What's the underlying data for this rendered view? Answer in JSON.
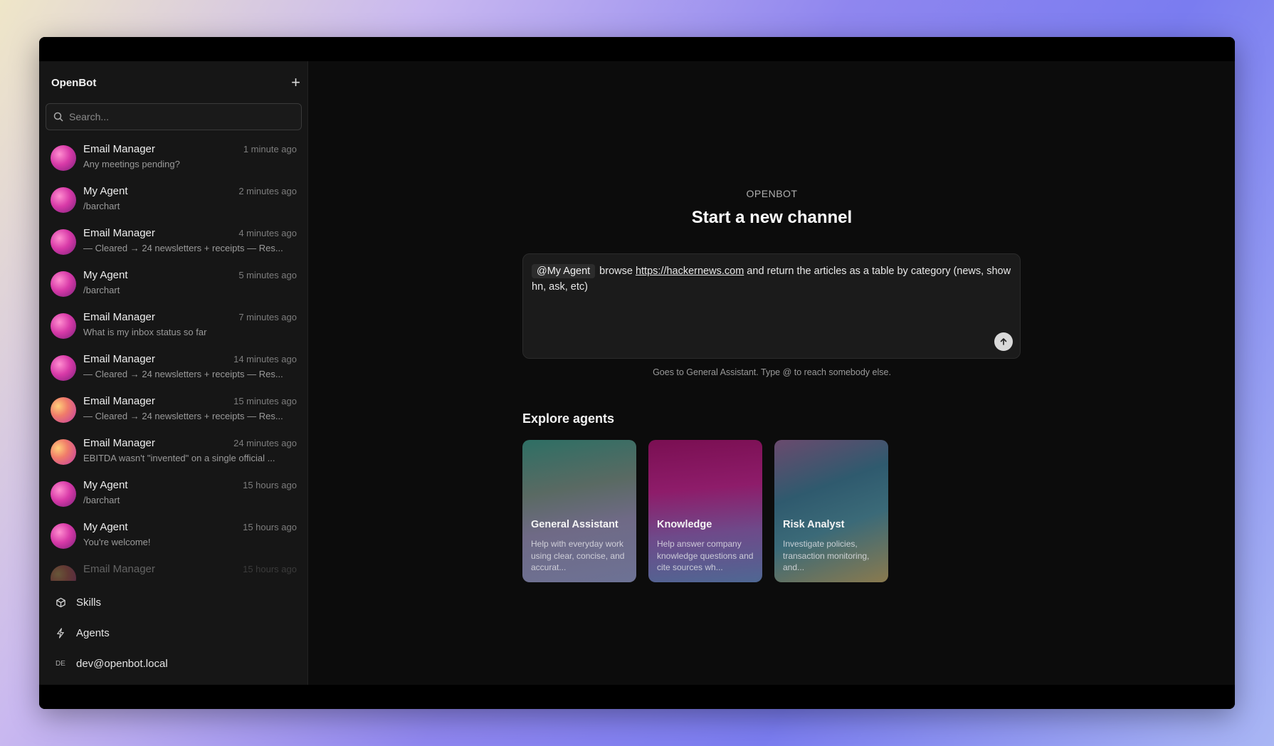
{
  "app": {
    "title": "OpenBot"
  },
  "search": {
    "placeholder": "Search..."
  },
  "conversations": [
    {
      "name": "Email Manager",
      "time": "1 minute ago",
      "preview": "Any meetings pending?",
      "avatar": "pink"
    },
    {
      "name": "My Agent",
      "time": "2 minutes ago",
      "preview": "/barchart",
      "avatar": "pink"
    },
    {
      "name": "Email Manager",
      "time": "4 minutes ago",
      "preview": "— Cleared → 24 newsletters + receipts — Res...",
      "avatar": "pink"
    },
    {
      "name": "My Agent",
      "time": "5 minutes ago",
      "preview": "/barchart",
      "avatar": "pink"
    },
    {
      "name": "Email Manager",
      "time": "7 minutes ago",
      "preview": "What is my inbox status so far",
      "avatar": "pink"
    },
    {
      "name": "Email Manager",
      "time": "14 minutes ago",
      "preview": "— Cleared → 24 newsletters + receipts — Res...",
      "avatar": "pink"
    },
    {
      "name": "Email Manager",
      "time": "15 minutes ago",
      "preview": "— Cleared → 24 newsletters + receipts — Res...",
      "avatar": "orange"
    },
    {
      "name": "Email Manager",
      "time": "24 minutes ago",
      "preview": "EBITDA wasn't \"invented\" on a single official ...",
      "avatar": "orange"
    },
    {
      "name": "My Agent",
      "time": "15 hours ago",
      "preview": "/barchart",
      "avatar": "pink"
    },
    {
      "name": "My Agent",
      "time": "15 hours ago",
      "preview": "You're welcome!",
      "avatar": "pink"
    },
    {
      "name": "Email Manager",
      "time": "15 hours ago",
      "preview": "",
      "avatar": "orange"
    }
  ],
  "nav": {
    "skills": "Skills",
    "agents": "Agents"
  },
  "user": {
    "initials": "DE",
    "email": "dev@openbot.local"
  },
  "main": {
    "eyebrow": "OPENBOT",
    "headline": "Start a new channel",
    "composer": {
      "mention": "@My Agent",
      "text_before": "browse ",
      "link": "https://hackernews.com",
      "text_after": " and return the articles as a table by category (news, show hn, ask, etc)"
    },
    "hint": "Goes to General Assistant. Type @ to reach somebody else.",
    "explore_title": "Explore agents",
    "agents": [
      {
        "name": "General Assistant",
        "desc": "Help with everyday work using clear, concise, and accurat..."
      },
      {
        "name": "Knowledge",
        "desc": "Help answer company knowledge questions and cite sources wh..."
      },
      {
        "name": "Risk Analyst",
        "desc": "Investigate policies, transaction monitoring, and..."
      }
    ]
  },
  "icons": {
    "search": "search-icon",
    "plus": "plus-icon",
    "skills": "cube-icon",
    "agents": "bolt-icon",
    "send": "arrow-up-icon"
  }
}
